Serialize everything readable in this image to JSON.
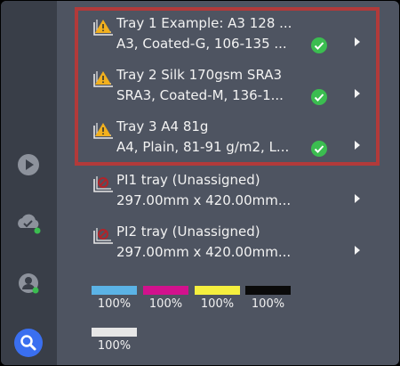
{
  "trays": [
    {
      "line1": "Tray 1 Example: A3 128 ...",
      "line2": "A3, Coated-G, 106-135 ...",
      "icon": "warning-tray-icon",
      "status_ok": true
    },
    {
      "line1": "Tray 2 Silk 170gsm SRA3",
      "line2": "SRA3, Coated-M, 136-1...",
      "icon": "warning-tray-icon",
      "status_ok": true
    },
    {
      "line1": "Tray 3 A4 81g",
      "line2": "A4, Plain, 81-91 g/m2, L...",
      "icon": "warning-tray-icon",
      "status_ok": true
    },
    {
      "line1": "PI1 tray (Unassigned)",
      "line2": "297.00mm x 420.00mm...",
      "icon": "error-tray-icon",
      "status_ok": false
    },
    {
      "line1": "PI2 tray (Unassigned)",
      "line2": "297.00mm x 420.00mm...",
      "icon": "error-tray-icon",
      "status_ok": false
    }
  ],
  "supplies": [
    {
      "color": "#5bb3e6",
      "label": "100%"
    },
    {
      "color": "#d2118d",
      "label": "100%"
    },
    {
      "color": "#f5ef3e",
      "label": "100%"
    },
    {
      "color": "#0a0a0a",
      "label": "100%"
    },
    {
      "color": "#e6e6e6",
      "label": "100%"
    }
  ],
  "rail": [
    "play-icon",
    "cloud-check-icon",
    "user-status-icon",
    "search-icon"
  ],
  "colors": {
    "accent": "#3a6ff0",
    "status_green": "#3bbd50",
    "warning": "#f2b01e",
    "highlight": "#b23a3a"
  }
}
